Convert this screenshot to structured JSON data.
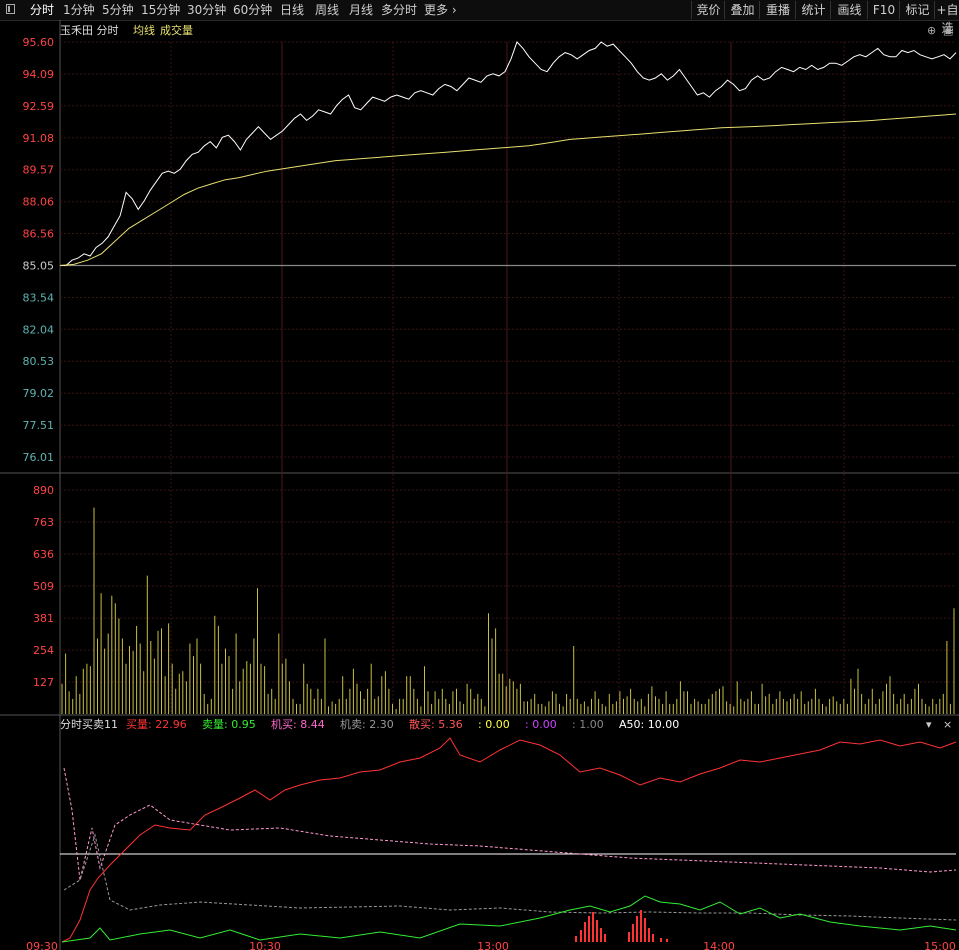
{
  "toolbar": {
    "tabs": [
      "分时",
      "1分钟",
      "5分钟",
      "15分钟",
      "30分钟",
      "60分钟",
      "日线",
      "周线",
      "月线",
      "多分时",
      "更多"
    ],
    "active_tab": "分时",
    "right_buttons": [
      "竞价",
      "叠加",
      "重播",
      "统计",
      "画线",
      "F10",
      "标记",
      "+自选"
    ]
  },
  "price_header": {
    "name": "玉禾田",
    "mode": "分时",
    "avg_label": "均线",
    "vol_label": "成交量"
  },
  "price_axis": [
    "95.60",
    "94.09",
    "92.59",
    "91.08",
    "89.57",
    "88.06",
    "86.56",
    "85.05",
    "83.54",
    "82.04",
    "80.53",
    "79.02",
    "77.51",
    "76.01"
  ],
  "volume_axis": [
    "890",
    "763",
    "636",
    "509",
    "381",
    "254",
    "127"
  ],
  "indicator_header": {
    "name": "分时买卖11",
    "items": [
      {
        "label": "买量:",
        "value": "22.96",
        "color": "#ff3333"
      },
      {
        "label": "卖量:",
        "value": "0.95",
        "color": "#33ee33"
      },
      {
        "label": "机买:",
        "value": "8.44",
        "color": "#ff66cc"
      },
      {
        "label": "机卖:",
        "value": "2.30",
        "color": "#999999"
      },
      {
        "label": "散买:",
        "value": "5.36",
        "color": "#ff5555"
      },
      {
        "label": ":",
        "value": "0.00",
        "color": "#ffff44"
      },
      {
        "label": ":",
        "value": "0.00",
        "color": "#cc44ff"
      },
      {
        "label": ":",
        "value": "1.00",
        "color": "#888888"
      },
      {
        "label": "A50:",
        "value": "10.00",
        "color": "#ffffff"
      }
    ]
  },
  "time_axis": [
    "09:30",
    "10:30",
    "13:00",
    "14:00",
    "15:00"
  ],
  "colors": {
    "up": "#ff3333",
    "down": "#33ee33",
    "price_line": "#ffffff",
    "avg_line": "#e8e070",
    "volume": "#c8c040",
    "grid": "#3a1212"
  },
  "chart_data": {
    "type": "line",
    "price": [
      85.05,
      85.05,
      85.3,
      85.4,
      85.6,
      85.5,
      85.9,
      86.1,
      86.4,
      86.9,
      87.4,
      88.5,
      88.2,
      87.7,
      88.1,
      88.6,
      89.0,
      89.4,
      89.5,
      89.4,
      89.6,
      90.0,
      90.3,
      90.4,
      90.7,
      90.9,
      90.6,
      91.1,
      91.2,
      90.9,
      90.5,
      91.0,
      91.3,
      91.6,
      91.3,
      91.0,
      91.2,
      91.4,
      91.7,
      92.0,
      92.2,
      91.9,
      92.1,
      92.4,
      92.3,
      92.2,
      92.6,
      92.9,
      93.1,
      92.5,
      92.4,
      92.7,
      93.0,
      92.9,
      92.8,
      93.0,
      93.1,
      93.0,
      92.9,
      93.2,
      93.3,
      93.2,
      93.1,
      93.4,
      93.6,
      93.5,
      93.3,
      93.6,
      93.9,
      93.8,
      93.7,
      94.0,
      94.1,
      94.0,
      94.2,
      94.8,
      95.6,
      95.3,
      94.9,
      94.6,
      94.3,
      94.2,
      94.6,
      94.9,
      95.1,
      95.0,
      94.8,
      95.0,
      95.2,
      95.3,
      95.6,
      95.4,
      95.5,
      95.2,
      94.9,
      94.6,
      94.2,
      93.9,
      93.8,
      93.9,
      94.1,
      93.8,
      94.0,
      94.3,
      93.9,
      93.5,
      93.1,
      93.2,
      93.0,
      93.3,
      93.5,
      93.8,
      93.6,
      93.3,
      93.4,
      93.8,
      94.0,
      93.8,
      93.9,
      94.2,
      94.4,
      94.3,
      94.2,
      94.4,
      94.3,
      94.5,
      94.3,
      94.4,
      94.6,
      94.6,
      94.5,
      94.7,
      94.9,
      95.0,
      94.9,
      95.1,
      95.3,
      95.0,
      94.9,
      94.9,
      95.2,
      95.1,
      95.2,
      95.0,
      94.9,
      94.8,
      94.9,
      95.0,
      94.8,
      95.1
    ],
    "avg": [
      85.05,
      85.1,
      85.3,
      85.6,
      86.2,
      86.8,
      87.2,
      87.6,
      88.0,
      88.4,
      88.7,
      88.9,
      89.1,
      89.2,
      89.35,
      89.5,
      89.6,
      89.7,
      89.8,
      89.9,
      90.0,
      90.05,
      90.1,
      90.15,
      90.2,
      90.25,
      90.3,
      90.35,
      90.4,
      90.45,
      90.5,
      90.55,
      90.6,
      90.65,
      90.7,
      90.8,
      90.9,
      91.0,
      91.05,
      91.1,
      91.15,
      91.2,
      91.25,
      91.3,
      91.35,
      91.4,
      91.45,
      91.5,
      91.55,
      91.58,
      91.6,
      91.63,
      91.66,
      91.7,
      91.73,
      91.76,
      91.8,
      91.83,
      91.86,
      91.9,
      91.95,
      92.0,
      92.05,
      92.1,
      92.15,
      92.2
    ],
    "volume": [
      120,
      240,
      90,
      60,
      150,
      80,
      180,
      200,
      190,
      820,
      300,
      480,
      260,
      320,
      470,
      440,
      380,
      300,
      200,
      270,
      250,
      350,
      280,
      170,
      550,
      290,
      220,
      330,
      340,
      150,
      360,
      200,
      100,
      160,
      170,
      130,
      280,
      230,
      300,
      200,
      80,
      40,
      60,
      390,
      350,
      200,
      260,
      230,
      100,
      320,
      130,
      180,
      210,
      200,
      300,
      500,
      200,
      190,
      80,
      100,
      60,
      320,
      200,
      220,
      130,
      60,
      40,
      40,
      200,
      120,
      100,
      60,
      100,
      60,
      300,
      30,
      50,
      40,
      60,
      150,
      60,
      100,
      180,
      120,
      90,
      60,
      100,
      200,
      60,
      70,
      150,
      170,
      100,
      40,
      20,
      60,
      60,
      150,
      150,
      100,
      60,
      30,
      190,
      90,
      40,
      90,
      60,
      100,
      60,
      40,
      90,
      100,
      50,
      40,
      120,
      100,
      60,
      80,
      60,
      30,
      400,
      300,
      340,
      160,
      160,
      110,
      140,
      130,
      100,
      120,
      50,
      50,
      60,
      80,
      40,
      40,
      30,
      50,
      90,
      80,
      40,
      30,
      80,
      60,
      270,
      60,
      40,
      50,
      30,
      60,
      90,
      60,
      40,
      30,
      80,
      40,
      50,
      90,
      60,
      70,
      100,
      60,
      50,
      60,
      30,
      80,
      110,
      70,
      60,
      40,
      90,
      40,
      40,
      60,
      130,
      90,
      90,
      40,
      60,
      50,
      40,
      40,
      60,
      80,
      90,
      100,
      110,
      50,
      40,
      30,
      130,
      60,
      50,
      60,
      90,
      40,
      40,
      120,
      70,
      80,
      40,
      60,
      90,
      60,
      50,
      60,
      80,
      60,
      90,
      40,
      50,
      60,
      100,
      60,
      40,
      30,
      60,
      70,
      50,
      40,
      60,
      40,
      140,
      100,
      180,
      80,
      40,
      60,
      100,
      40,
      60,
      90,
      120,
      150,
      80,
      40,
      60,
      80,
      40,
      60,
      100,
      120,
      60,
      40,
      30,
      60,
      40,
      60,
      80,
      290,
      40,
      420
    ]
  }
}
